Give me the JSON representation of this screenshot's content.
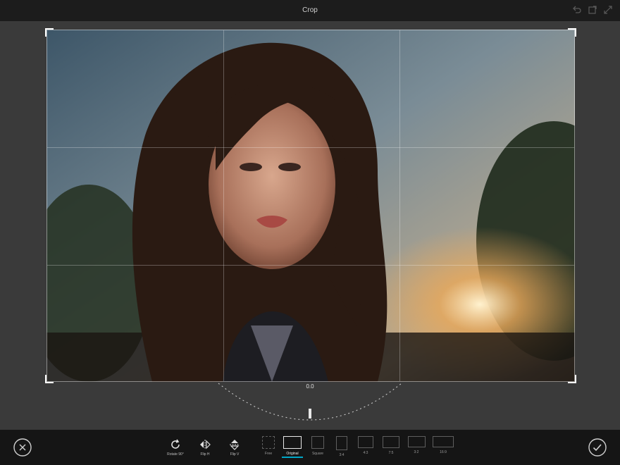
{
  "app": {
    "title": "Crop"
  },
  "top_actions": [
    {
      "name": "undo-icon"
    },
    {
      "name": "redo-icon"
    },
    {
      "name": "expand-icon"
    }
  ],
  "crop": {
    "angle_readout": "0.0"
  },
  "toolbar": {
    "cancel_icon": "close-circle-icon",
    "confirm_icon": "check-circle-icon",
    "tools": [
      {
        "label": "Rotate 90°",
        "icon": "rotate-icon"
      },
      {
        "label": "Flip H",
        "icon": "flip-horizontal-icon"
      },
      {
        "label": "Flip V",
        "icon": "flip-vertical-icon"
      }
    ],
    "ratios": [
      {
        "label": "Free",
        "selected": false
      },
      {
        "label": "Original",
        "selected": true
      },
      {
        "label": "Square",
        "selected": false
      },
      {
        "label": "3:4",
        "selected": false
      },
      {
        "label": "4:3",
        "selected": false
      },
      {
        "label": "7:5",
        "selected": false
      },
      {
        "label": "3:2",
        "selected": false
      },
      {
        "label": "16:9",
        "selected": false
      }
    ]
  },
  "colors": {
    "accent": "#00a8c8",
    "toolbar_bg": "#151515",
    "topbar_bg": "#1c1c1c",
    "canvas_bg": "#3a3a3a"
  }
}
